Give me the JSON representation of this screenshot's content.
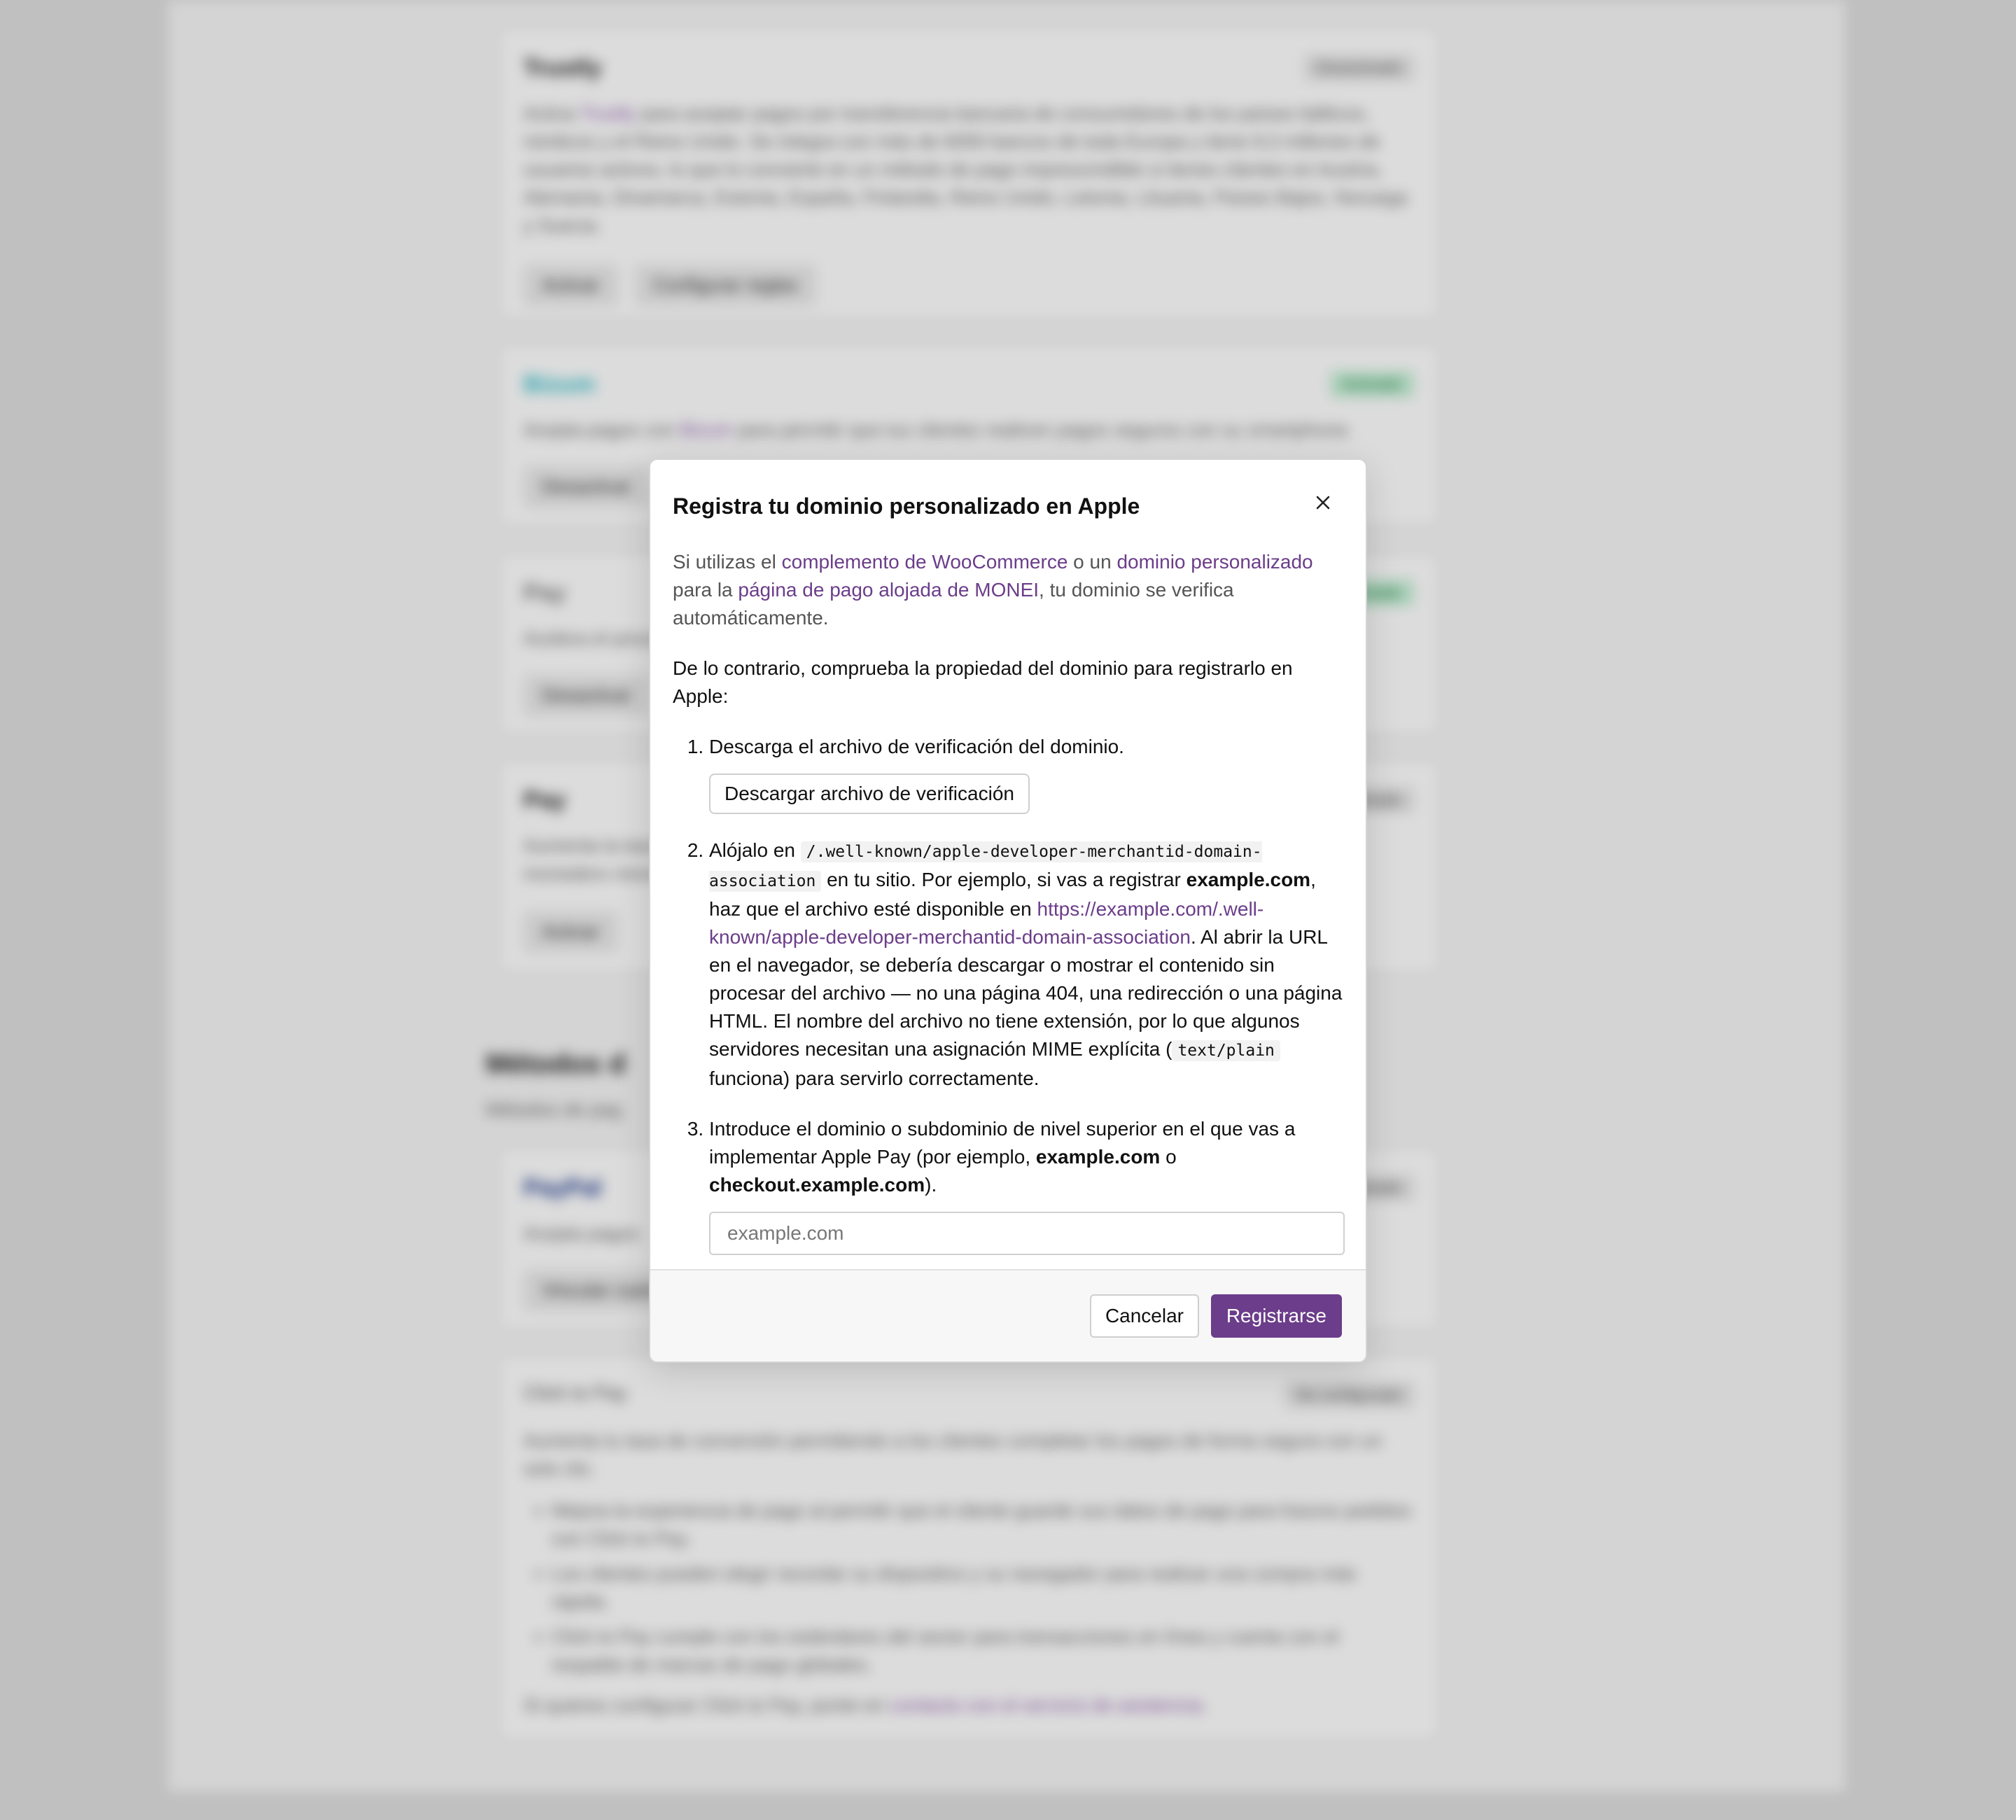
{
  "background": {
    "cards": [
      {
        "title": "Trustly",
        "badge": "Desactivado",
        "description_pre": "Activa ",
        "description_link": "Trustly",
        "description_post": " para aceptar pagos por transferencia bancaria de consumidores de los países bálticos, nórdicos y el Reino Unido. Se integra con más de 6000 bancos de toda Europa y tiene 9,3 millones de usuarios activos, lo que lo convierte en un método de pago imprescindible si tienes clientes en Austria, Alemania, Dinamarca, Estonia, España, Finlandia, Reino Unido, Letonia, Lituania, Países Bajos, Noruega y Suecia.",
        "buttons": [
          "Activar",
          "Configurar reglas"
        ]
      },
      {
        "title": "Bizum",
        "badge": "Activado",
        "description_pre": "Acepta pagos con ",
        "description_link": "Bizum",
        "description_post": " para permitir que tus clientes realicen pagos seguros con su smartphone.",
        "buttons": [
          "Desactivar"
        ]
      },
      {
        "title": "Pay",
        "badge": "Activado",
        "description_pre": "Acelera el proceso de pago",
        "description_link": "",
        "description_post": "",
        "buttons": [
          "Desactivar"
        ]
      },
      {
        "title": "Pay",
        "badge": "Desactivado",
        "description_pre": "Aumenta la tasa de conversión",
        "description_link": "",
        "description_post": "monedero móvil",
        "buttons": [
          "Activar"
        ]
      },
      {
        "title": "PayPal",
        "badge": "Desactivado",
        "description_pre": "Acepta pagos",
        "description_link": "",
        "description_post": "",
        "buttons": [
          "Vincular cuenta"
        ]
      }
    ],
    "section_title": "Métodos d",
    "section_subtitle": "Métodos de pag",
    "click_to_pay": {
      "title": "Click to Pay",
      "badge": "No configurado",
      "description": "Aumenta tu tasa de conversión permitiendo a los clientes completar los pagos de forma segura con un solo clic.",
      "bullets": [
        "Mejora la experiencia de pago al permitir que el cliente guarde sus datos de pago para futuros pedidos con Click to Pay.",
        "Los clientes pueden elegir recordar su dispositivo y su navegador para realizar una compra más rápida.",
        "Click to Pay cumple con los estándares del sector para transacciones en línea y cuenta con el respaldo de marcas de pago globales."
      ],
      "footer_pre": "Si quieres configurar Click to Pay, ponte en ",
      "footer_link": "contacto con el servicio de asistencia",
      "footer_post": "."
    }
  },
  "modal": {
    "title": "Registra tu dominio personalizado en Apple",
    "intro": {
      "t1": "Si utilizas el ",
      "link1": "complemento de WooCommerce",
      "t2": " o un ",
      "link2": "dominio personalizado",
      "t3": " para la ",
      "link3": "página de pago alojada de MONEI",
      "t4": ", tu dominio se verifica automáticamente."
    },
    "otherwise": "De lo contrario, comprueba la propiedad del dominio para registrarlo en Apple:",
    "step1": {
      "text": "Descarga el archivo de verificación del dominio.",
      "button": "Descargar archivo de verificación"
    },
    "step2": {
      "t1": "Alójalo en ",
      "code_path": "/.well-known/apple-developer-merchantid-domain-association",
      "t2": " en tu sitio. Por ejemplo, si vas a registrar ",
      "bold_domain": "example.com",
      "t3": ", haz que el archivo esté disponible en ",
      "link_url": "https://example.com/.well-known/apple-developer-merchantid-domain-association",
      "t4": ". Al abrir la URL en el navegador, se debería descargar o mostrar el contenido sin procesar del archivo — no una página 404, una redirección o una página HTML. El nombre del archivo no tiene extensión, por lo que algunos servidores necesitan una asignación MIME explícita (",
      "code_mime": "text/plain",
      "t5": " funciona) para servirlo correctamente."
    },
    "step3": {
      "t1": "Introduce el dominio o subdominio de nivel superior en el que vas a implementar Apple Pay (por ejemplo, ",
      "bold1": "example.com",
      "t2": " o ",
      "bold2": "checkout.example.com",
      "t3": ").",
      "input_placeholder": "example.com",
      "input_value": ""
    },
    "footer": {
      "cancel": "Cancelar",
      "submit": "Registrarse"
    },
    "accent_color": "#6b3d8a"
  }
}
